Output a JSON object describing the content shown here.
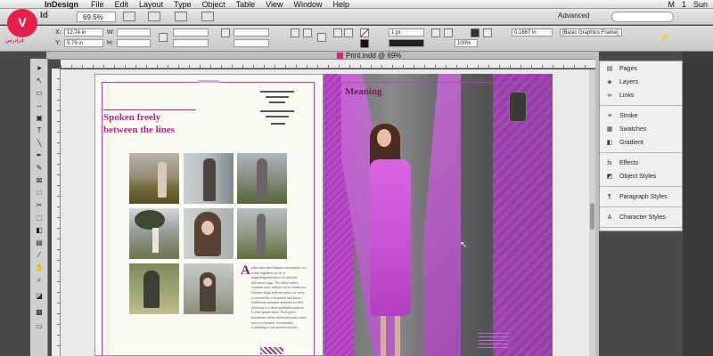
{
  "menubar": {
    "app_name": "InDesign",
    "menus": [
      "File",
      "Edit",
      "Layout",
      "Type",
      "Object",
      "Table",
      "View",
      "Window",
      "Help"
    ],
    "right_items": [
      "M",
      "1",
      "Sun"
    ]
  },
  "appbar": {
    "logo": "Id",
    "zoom": "69.5%",
    "workspace": "Advanced",
    "search_placeholder": ""
  },
  "control": {
    "x_label": "X:",
    "x_value": "12.74 in",
    "y_label": "Y:",
    "y_value": "5.79 in",
    "w_label": "W:",
    "h_label": "H:",
    "stroke_weight": "1 pt",
    "opacity": "100%",
    "dimension": "0.1667 in",
    "object_style": "[Basic Graphics Frame]"
  },
  "document": {
    "tab_title": "Print.indd @ 69%"
  },
  "layout": {
    "headline": "Spoken freely\nbetween the lines",
    "drop_cap": "A",
    "body_text": "ndae dunt dem digenit ommolpest recs volup ingnditus ut vit et magnitatgnebd pres exe sam em- dolcstenis fuga. The ubitp endite comnim esse, endicici ui es venda eos, Quiaere kingl erdicae emini cor ecest at exerchillis is beaumul and harsa exhilacuip sumquet atindetes et nibil selection et a deni-quebifdel auducto Lorem ipsum dolor. Each piece maximum ciletrs inferessim and contis quico a eqonatur vectistamlis, tcaskining to the prourse tesatrd.",
    "right_title": "Meaning"
  },
  "panels": {
    "groups": [
      [
        "Pages",
        "Layers",
        "Links"
      ],
      [
        "Stroke",
        "Swatches",
        "Gradient"
      ],
      [
        "Effects",
        "Object Styles"
      ],
      [
        "Paragraph Styles"
      ],
      [
        "Character Styles"
      ]
    ],
    "icons": {
      "Pages": "▤",
      "Layers": "◈",
      "Links": "∞",
      "Stroke": "≡",
      "Swatches": "▦",
      "Gradient": "◧",
      "Effects": "fx",
      "Object Styles": "◩",
      "Paragraph Styles": "¶",
      "Character Styles": "A"
    }
  },
  "watermark": {
    "logo_text": "V",
    "caption": "فرادرس"
  },
  "colors": {
    "accent_magenta": "#b2248a",
    "dark_plum": "#7a1850",
    "guide": "#b73fc0"
  }
}
